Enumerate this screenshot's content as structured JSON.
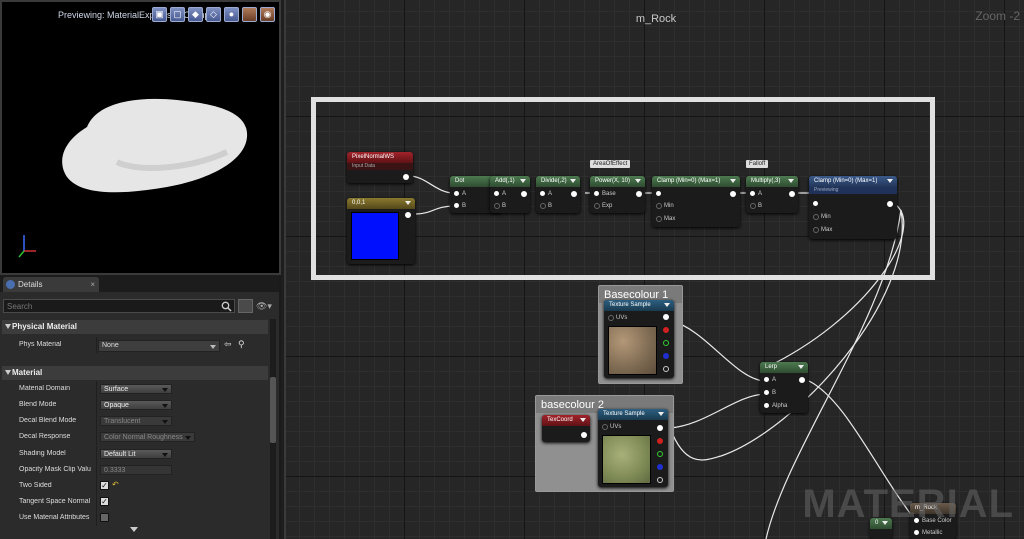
{
  "viewport": {
    "title": "Previewing: MaterialExpressionClamp_1",
    "buttons": [
      "▣",
      "▢",
      "◆",
      "◇",
      "●",
      "",
      "◉"
    ]
  },
  "details": {
    "tab_label": "Details",
    "search_placeholder": "Search",
    "categories": {
      "physical": "Physical Material",
      "material": "Material"
    },
    "phys_material": {
      "label": "Phys Material",
      "value": "None"
    },
    "properties": [
      {
        "label": "Material Domain",
        "value": "Surface",
        "type": "combo"
      },
      {
        "label": "Blend Mode",
        "value": "Opaque",
        "type": "combo"
      },
      {
        "label": "Decal Blend Mode",
        "value": "Translucent",
        "type": "combo-dim"
      },
      {
        "label": "Decal Response",
        "value": "Color Normal Roughness",
        "type": "combo-dim-wide"
      },
      {
        "label": "Shading Model",
        "value": "Default Lit",
        "type": "combo"
      },
      {
        "label": "Opacity Mask Clip Valu",
        "value": "0.3333",
        "type": "number"
      },
      {
        "label": "Two Sided",
        "value": "✓",
        "type": "check-reset"
      },
      {
        "label": "Tangent Space Normal",
        "value": "✓",
        "type": "check"
      },
      {
        "label": "Use Material Attributes",
        "value": "",
        "type": "check-off"
      }
    ]
  },
  "graph": {
    "title": "m_Rock",
    "zoom": "Zoom -2",
    "watermark": "MATERIAL",
    "nodes": {
      "pixelnormal": {
        "title": "PixelNormalWS",
        "sub": "Input Data"
      },
      "const3": {
        "title": "0,0,1"
      },
      "dot": {
        "title": "Dot",
        "pins": [
          "A",
          "B"
        ]
      },
      "add": {
        "title": "Add(,1)",
        "pins": [
          "A",
          "B"
        ]
      },
      "divide": {
        "title": "Divide(,2)",
        "pins": [
          "A",
          "B"
        ]
      },
      "power": {
        "title": "Power(X, 10)",
        "pins": [
          "Base",
          "Exp"
        ],
        "tag": "AreaOfEffect"
      },
      "clamp1": {
        "title": "Clamp (Min=0) (Max=1)",
        "pins": [
          "",
          "Min",
          "Max"
        ]
      },
      "multiply": {
        "title": "Multiply(,3)",
        "pins": [
          "A",
          "B"
        ],
        "tag": "Falloff"
      },
      "clamp2": {
        "title": "Clamp (Min=0) (Max=1)",
        "sub": "Previewing",
        "pins": [
          "",
          "Min",
          "Max"
        ]
      },
      "tex1": {
        "title": "Texture Sample",
        "pins": [
          "UVs"
        ],
        "comment": "Basecolour 1"
      },
      "tex2": {
        "title": "Texture Sample",
        "pins": [
          "UVs"
        ],
        "comment": "basecolour 2"
      },
      "texcoord": {
        "title": "TexCoord"
      },
      "lerp": {
        "title": "Lerp",
        "pins": [
          "A",
          "B",
          "Alpha"
        ]
      },
      "const0": {
        "title": "0"
      },
      "result": {
        "title": "m_Rock",
        "pins": [
          "Base Color",
          "Metallic"
        ]
      }
    }
  }
}
